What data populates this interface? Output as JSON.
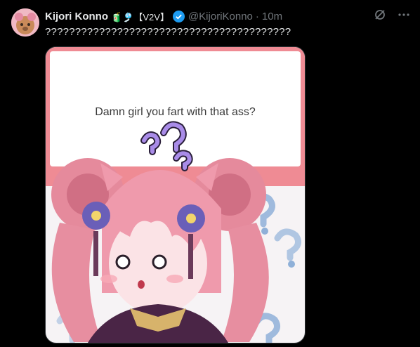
{
  "post": {
    "display_name": "Kijori Konno",
    "name_emojis": "🧃🎐【V2V】",
    "handle": "@KijoriKonno",
    "separator": "·",
    "timestamp": "10m",
    "text": "?????????????????????????????????????????",
    "media": {
      "question_text": "Damn girl you fart with that ass?",
      "card_color": "#ef8b94"
    }
  },
  "icons": {
    "verified": "verified-badge-icon",
    "grok": "grok-icon",
    "more": "more-icon"
  },
  "colors": {
    "accent": "#1d9bf0",
    "muted": "#71767b",
    "text": "#e7e9ea"
  }
}
